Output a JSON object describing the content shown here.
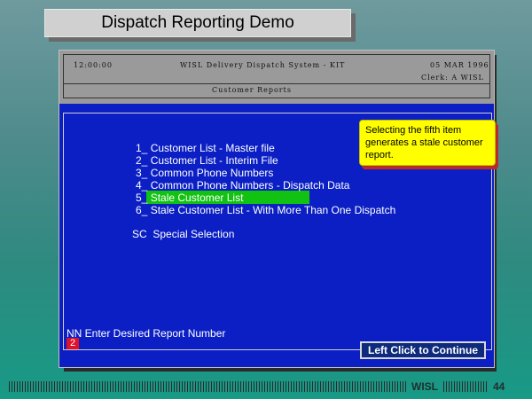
{
  "slide": {
    "title": "Dispatch Reporting Demo",
    "footer_brand": "WISL",
    "page_number": "44"
  },
  "terminal": {
    "time": "12:00:00",
    "system_name": "WISL Delivery Dispatch System - KIT",
    "date": "05 MAR 1996",
    "clerk": "Clerk:  A WISL",
    "screen_title": "Customer Reports"
  },
  "menu": {
    "items": [
      {
        "number": "1_",
        "label": "Customer List - Master file"
      },
      {
        "number": "2_",
        "label": "Customer List - Interim File"
      },
      {
        "number": "3_",
        "label": "Common Phone Numbers"
      },
      {
        "number": "4_",
        "label": "Common Phone Numbers - Dispatch Data"
      },
      {
        "number": "5_",
        "label": "Stale Customer List"
      },
      {
        "number": "6_",
        "label": "Stale Customer List - With More Than One Dispatch"
      }
    ],
    "special": {
      "code": "SC",
      "label": "Special Selection"
    },
    "selected_index": 4,
    "highlight_color": "#12c212"
  },
  "callout": {
    "text": "Selecting the fifth item generates a stale customer report.",
    "color": "#ffff00"
  },
  "prompt": {
    "text": "NN Enter Desired Report Number",
    "value": "2"
  },
  "continue_button": {
    "label": "Left Click to Continue"
  },
  "colors": {
    "screen_bg": "#0b1fc4",
    "header_bg": "#9a9a9a",
    "input_cursor": "#e0102a"
  }
}
